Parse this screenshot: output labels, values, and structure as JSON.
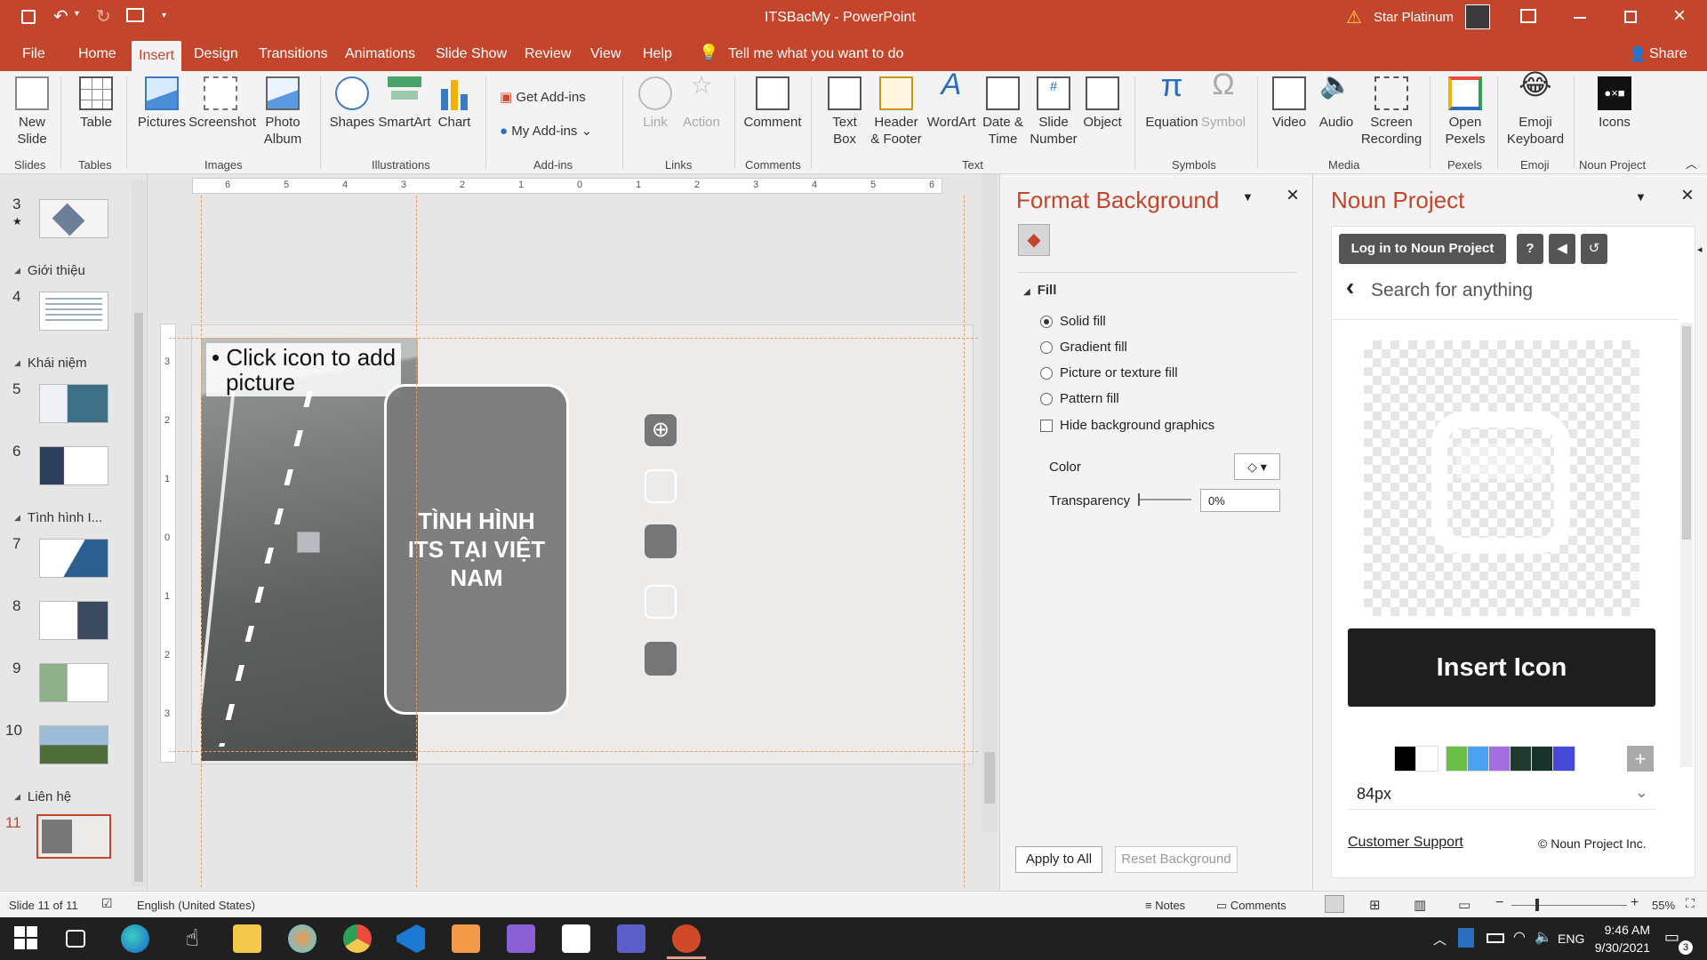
{
  "window": {
    "title": "ITSBacMy - PowerPoint",
    "user": "Star Platinum"
  },
  "tabs": [
    "File",
    "Home",
    "Insert",
    "Design",
    "Transitions",
    "Animations",
    "Slide Show",
    "Review",
    "View",
    "Help"
  ],
  "tell_me": "Tell me what you want to do",
  "share": "Share",
  "ribbon": {
    "new_slide": "New\nSlide",
    "table": "Table",
    "pictures": "Pictures",
    "screenshot": "Screenshot",
    "photo_album": "Photo\nAlbum",
    "shapes": "Shapes",
    "smartart": "SmartArt",
    "chart": "Chart",
    "get_addins": "Get Add-ins",
    "my_addins": "My Add-ins",
    "link": "Link",
    "action": "Action",
    "comment": "Comment",
    "text_box": "Text\nBox",
    "header_footer": "Header\n& Footer",
    "wordart": "WordArt",
    "date_time": "Date &\nTime",
    "slide_number": "Slide\nNumber",
    "object": "Object",
    "equation": "Equation",
    "symbol": "Symbol",
    "video": "Video",
    "audio": "Audio",
    "screen_recording": "Screen\nRecording",
    "open_pexels": "Open\nPexels",
    "emoji_keyboard": "Emoji\nKeyboard",
    "icons": "Icons",
    "groups": [
      "Slides",
      "Tables",
      "Images",
      "Illustrations",
      "Add-ins",
      "Links",
      "Comments",
      "Text",
      "Symbols",
      "Media",
      "Pexels",
      "Emoji",
      "Noun Project"
    ]
  },
  "thumbnails": {
    "sections": [
      "Giới thiệu",
      "Khái niệm",
      "Tình hình I...",
      "Liên hệ"
    ],
    "numbers": [
      "3",
      "4",
      "5",
      "6",
      "7",
      "8",
      "9",
      "10",
      "11"
    ]
  },
  "slide": {
    "placeholder_line1": "• Click icon to add",
    "placeholder_line2": "picture",
    "title": "TÌNH HÌNH\nITS TẠI VIỆT\nNAM"
  },
  "ruler_top": [
    "6",
    "5",
    "4",
    "3",
    "2",
    "1",
    "0",
    "1",
    "2",
    "3",
    "4",
    "5",
    "6"
  ],
  "ruler_left": [
    "3",
    "2",
    "1",
    "0",
    "1",
    "2",
    "3"
  ],
  "format_background": {
    "title": "Format Background",
    "section": "Fill",
    "options": [
      "Solid fill",
      "Gradient fill",
      "Picture or texture fill",
      "Pattern fill"
    ],
    "hide_graphics": "Hide background graphics",
    "color_label": "Color",
    "transparency_label": "Transparency",
    "transparency_value": "0%",
    "apply_all": "Apply to All",
    "reset": "Reset Background"
  },
  "noun_project": {
    "title": "Noun Project",
    "login": "Log in to Noun Project",
    "search_placeholder": "Search for anything",
    "insert": "Insert Icon",
    "size": "84px",
    "support": "Customer Support",
    "copyright": "© Noun Project Inc.",
    "swatches": [
      "#000000",
      "#ffffff",
      "#6cc04a",
      "#4aa3ef",
      "#a56ee0",
      "#1f3a2f",
      "#15332b",
      "#4848d6"
    ]
  },
  "status": {
    "slide": "Slide 11 of 11",
    "language": "English (United States)",
    "notes": "Notes",
    "comments": "Comments",
    "zoom": "55%"
  },
  "taskbar": {
    "time": "9:46 AM",
    "date": "9/30/2021",
    "lang": "ENG",
    "notifications": "3"
  }
}
